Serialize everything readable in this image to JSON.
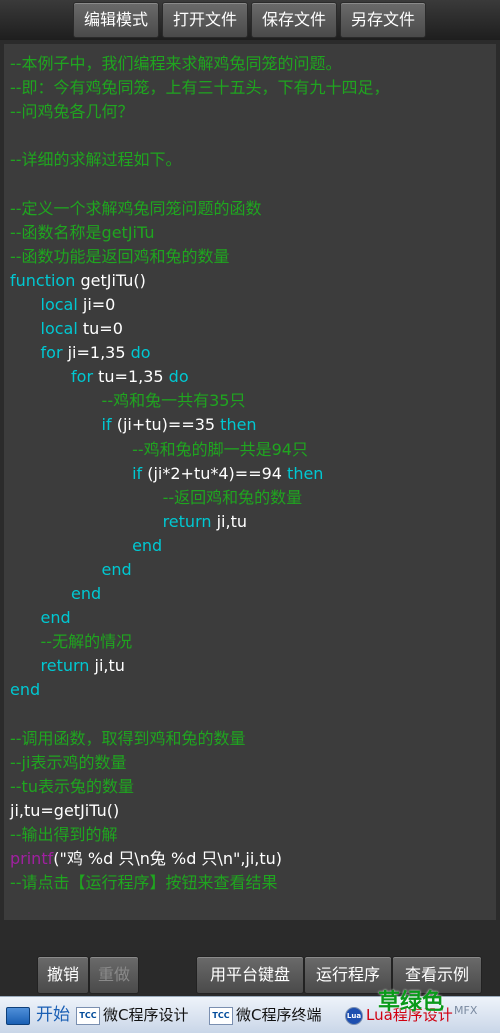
{
  "toolbar": {
    "edit_mode": "编辑模式",
    "open_file": "打开文件",
    "save_file": "保存文件",
    "save_as": "另存文件"
  },
  "code": [
    [
      {
        "t": "--本例子中，我们编程来求解鸡兔同笼的问题。",
        "c": "c"
      }
    ],
    [
      {
        "t": "--即：今有鸡兔同笼，上有三十五头，下有九十四足，",
        "c": "c"
      }
    ],
    [
      {
        "t": "--问鸡兔各几何？",
        "c": "c"
      }
    ],
    [],
    [
      {
        "t": "--详细的求解过程如下。",
        "c": "c"
      }
    ],
    [],
    [
      {
        "t": "--定义一个求解鸡兔同笼问题的函数",
        "c": "c"
      }
    ],
    [
      {
        "t": "--函数名称是getJiTu",
        "c": "c"
      }
    ],
    [
      {
        "t": "--函数功能是返回鸡和兔的数量",
        "c": "c"
      }
    ],
    [
      {
        "t": "function",
        "c": "k"
      },
      {
        "t": " getJiTu()",
        "c": "w"
      }
    ],
    [
      {
        "t": "      "
      },
      {
        "t": "local",
        "c": "k"
      },
      {
        "t": " ji=0",
        "c": "w"
      }
    ],
    [
      {
        "t": "      "
      },
      {
        "t": "local",
        "c": "k"
      },
      {
        "t": " tu=0",
        "c": "w"
      }
    ],
    [
      {
        "t": "      "
      },
      {
        "t": "for",
        "c": "k"
      },
      {
        "t": " ji=1,35 ",
        "c": "w"
      },
      {
        "t": "do",
        "c": "k"
      }
    ],
    [
      {
        "t": "            "
      },
      {
        "t": "for",
        "c": "k"
      },
      {
        "t": " tu=1,35 ",
        "c": "w"
      },
      {
        "t": "do",
        "c": "k"
      }
    ],
    [
      {
        "t": "                  "
      },
      {
        "t": "--鸡和兔一共有35只",
        "c": "c"
      }
    ],
    [
      {
        "t": "                  "
      },
      {
        "t": "if",
        "c": "k"
      },
      {
        "t": " (ji+tu)==35 ",
        "c": "w"
      },
      {
        "t": "then",
        "c": "k"
      }
    ],
    [
      {
        "t": "                        "
      },
      {
        "t": "--鸡和兔的脚一共是94只",
        "c": "c"
      }
    ],
    [
      {
        "t": "                        "
      },
      {
        "t": "if",
        "c": "k"
      },
      {
        "t": " (ji*2+tu*4)==94 ",
        "c": "w"
      },
      {
        "t": "then",
        "c": "k"
      }
    ],
    [
      {
        "t": "                              "
      },
      {
        "t": "--返回鸡和兔的数量",
        "c": "c"
      }
    ],
    [
      {
        "t": "                              "
      },
      {
        "t": "return",
        "c": "k"
      },
      {
        "t": " ji,tu",
        "c": "w"
      }
    ],
    [
      {
        "t": "                        "
      },
      {
        "t": "end",
        "c": "k"
      }
    ],
    [
      {
        "t": "                  "
      },
      {
        "t": "end",
        "c": "k"
      }
    ],
    [
      {
        "t": "            "
      },
      {
        "t": "end",
        "c": "k"
      }
    ],
    [
      {
        "t": "      "
      },
      {
        "t": "end",
        "c": "k"
      }
    ],
    [
      {
        "t": "      "
      },
      {
        "t": "--无解的情况",
        "c": "c"
      }
    ],
    [
      {
        "t": "      "
      },
      {
        "t": "return",
        "c": "k"
      },
      {
        "t": " ji,tu",
        "c": "w"
      }
    ],
    [
      {
        "t": "end",
        "c": "k"
      }
    ],
    [],
    [
      {
        "t": "--调用函数，取得到鸡和兔的数量",
        "c": "c"
      }
    ],
    [
      {
        "t": "--ji表示鸡的数量",
        "c": "c"
      }
    ],
    [
      {
        "t": "--tu表示兔的数量",
        "c": "c"
      }
    ],
    [
      {
        "t": "ji,tu=getJiTu()",
        "c": "w"
      }
    ],
    [
      {
        "t": "--输出得到的解",
        "c": "c"
      }
    ],
    [
      {
        "t": "printf",
        "c": "p"
      },
      {
        "t": "(\"鸡 %d 只\\n兔 %d 只\\n\",ji,tu)",
        "c": "w"
      }
    ],
    [
      {
        "t": "--请点击【运行程序】按钮来查看结果",
        "c": "c"
      }
    ]
  ],
  "bottom": {
    "undo": "撤销",
    "redo": "重做",
    "platform_keyboard": "用平台键盘",
    "run_program": "运行程序",
    "view_examples": "查看示例"
  },
  "taskbar": {
    "start": "开始",
    "task1_icon": "TCC",
    "task1": "微C程序设计",
    "task2_icon": "TCC",
    "task2": "微C程序终端",
    "task3_icon": "Lua",
    "task3": "Lua程序设计"
  },
  "overlay": {
    "green_text": "草绿色",
    "corner_text": "MFX"
  },
  "colors": {
    "comment": "#1fa51f",
    "keyword": "#00c8d2",
    "text": "#ffffff",
    "builtin": "#a020a0",
    "editor_bg": "#3c3c3c"
  }
}
